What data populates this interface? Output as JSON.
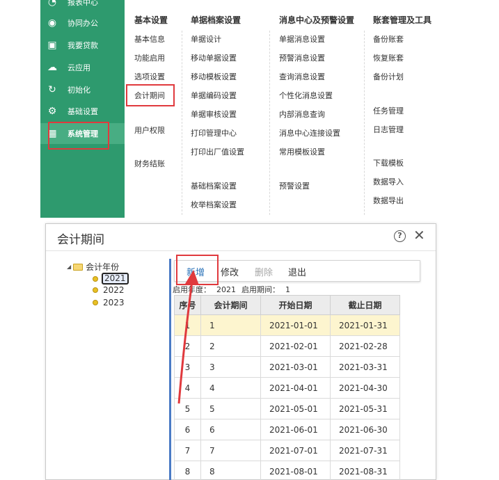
{
  "sidebar": {
    "items": [
      {
        "label": "报表中心",
        "icon": "report-icon"
      },
      {
        "label": "协同办公",
        "icon": "collab-icon"
      },
      {
        "label": "我要贷款",
        "icon": "loan-icon"
      },
      {
        "label": "云应用",
        "icon": "cloud-icon"
      },
      {
        "label": "初始化",
        "icon": "init-icon"
      },
      {
        "label": "基础设置",
        "icon": "settings-icon"
      },
      {
        "label": "系统管理",
        "icon": "system-icon"
      }
    ]
  },
  "menu": {
    "columns": [
      {
        "header": "基本设置",
        "items": [
          "基本信息",
          "功能启用",
          "选项设置",
          "会计期间",
          "用户权限",
          "财务结账"
        ]
      },
      {
        "header": "单据档案设置",
        "items": [
          "单据设计",
          "移动单据设置",
          "移动模板设置",
          "单据编码设置",
          "单据审核设置",
          "打印管理中心",
          "打印出厂值设置",
          "基础档案设置",
          "枚举档案设置"
        ]
      },
      {
        "header": "消息中心及预警设置",
        "items": [
          "单据消息设置",
          "预警消息设置",
          "查询消息设置",
          "个性化消息设置",
          "内部消息查询",
          "消息中心连接设置",
          "常用模板设置",
          "预警设置"
        ]
      },
      {
        "header": "账套管理及工具",
        "items": [
          "备份账套",
          "恢复账套",
          "备份计划",
          "任务管理",
          "日志管理",
          "下载模板",
          "数据导入",
          "数据导出"
        ]
      }
    ]
  },
  "dialog": {
    "title": "会计期间",
    "help": "?",
    "close": "✕",
    "tree": {
      "root": "会计年份",
      "years": [
        "2021",
        "2022",
        "2023"
      ],
      "selected": "2021"
    },
    "toolbar": {
      "add": "新增",
      "edit": "修改",
      "delete": "删除",
      "exit": "退出"
    },
    "info": {
      "year_label": "启用年度：",
      "year_value": "2021",
      "period_label": "启用期间：",
      "period_value": "1"
    },
    "table": {
      "headers": [
        "序号",
        "会计期间",
        "开始日期",
        "截止日期"
      ],
      "rows": [
        [
          "1",
          "1",
          "2021-01-01",
          "2021-01-31"
        ],
        [
          "2",
          "2",
          "2021-02-01",
          "2021-02-28"
        ],
        [
          "3",
          "3",
          "2021-03-01",
          "2021-03-31"
        ],
        [
          "4",
          "4",
          "2021-04-01",
          "2021-04-30"
        ],
        [
          "5",
          "5",
          "2021-05-01",
          "2021-05-31"
        ],
        [
          "6",
          "6",
          "2021-06-01",
          "2021-06-30"
        ],
        [
          "7",
          "7",
          "2021-07-01",
          "2021-07-31"
        ],
        [
          "8",
          "8",
          "2021-08-01",
          "2021-08-31"
        ]
      ]
    }
  },
  "colors": {
    "sidebar_bg": "#2e9a6e",
    "highlight": "#e0393d",
    "primary_text": "#2a72b8",
    "selected_row": "#fdf5cf"
  }
}
